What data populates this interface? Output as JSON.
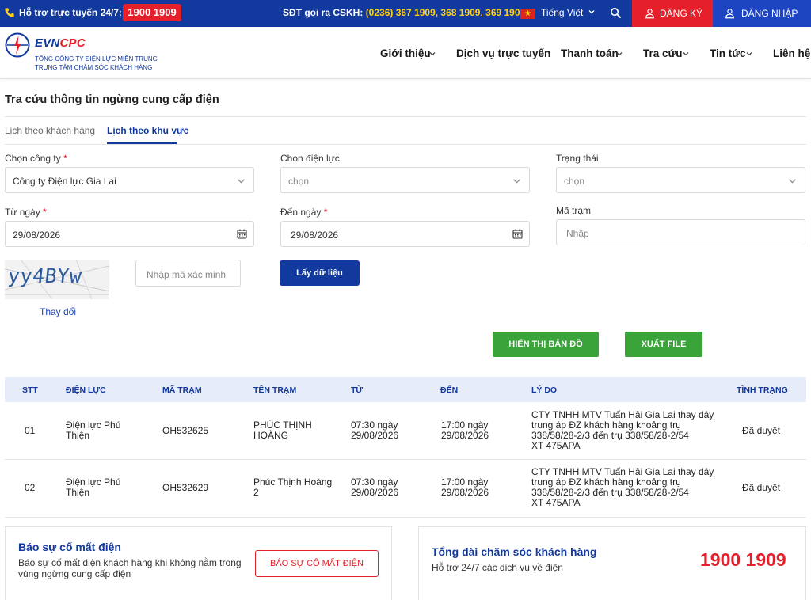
{
  "topbar": {
    "hotline_label": "Hỗ trợ trực tuyến 24/7:",
    "hotline_number": "1900 1909",
    "cskh_label": "SĐT gọi ra CSKH:",
    "cskh_numbers": "(0236) 367 1909, 368 1909, 369 1909",
    "language": "Tiếng Việt",
    "register": "ĐĂNG KÝ",
    "login": "ĐĂNG NHẬP"
  },
  "header": {
    "logo_evn": "EVN",
    "logo_cpc": "CPC",
    "logo_sub1": "TỔNG CÔNG TY ĐIỆN LỰC MIỀN TRUNG",
    "logo_sub2": "TRUNG TÂM CHĂM SÓC KHÁCH HÀNG",
    "nav": [
      "Giới thiệu",
      "Dịch vụ trực tuyến",
      "Thanh toán",
      "Tra cứu",
      "Tin tức",
      "Liên hệ"
    ]
  },
  "page": {
    "title": "Tra cứu thông tin ngừng cung cấp điện",
    "tabs": [
      "Lịch theo khách hàng",
      "Lịch theo khu vực"
    ]
  },
  "form": {
    "company_label": "Chọn công ty",
    "company_value": "Công ty Điện lực Gia Lai",
    "branch_label": "Chọn điện lực",
    "branch_value": "chọn",
    "status_label": "Trạng thái",
    "status_value": "chọn",
    "from_label": "Từ ngày",
    "from_value": "29/08/2026",
    "to_label": "Đến ngày",
    "to_value": "29/08/2026",
    "station_label": "Mã trạm",
    "station_placeholder": "Nhập",
    "captcha_text": "yy4BYw",
    "captcha_placeholder": "Nhập mã xác minh",
    "change_link": "Thay đổi",
    "fetch_button": "Lấy dữ liệu",
    "required_mark": "*"
  },
  "actions": {
    "show_map": "HIỂN THỊ BẢN ĐỒ",
    "export_file": "XUẤT FILE"
  },
  "table": {
    "headers": [
      "STT",
      "ĐIỆN LỰC",
      "MÃ TRẠM",
      "TÊN TRẠM",
      "TỪ",
      "ĐẾN",
      "LÝ DO",
      "TÌNH TRẠNG"
    ],
    "rows": [
      {
        "stt": "01",
        "dien_luc": [
          "Điện lực Phú",
          "Thiện"
        ],
        "ma_tram": "OH532625",
        "ten_tram": [
          "PHÚC THỊNH",
          "HOÀNG"
        ],
        "tu": [
          "07:30 ngày",
          "29/08/2026"
        ],
        "den": [
          "17:00 ngày",
          "29/08/2026"
        ],
        "ly_do": [
          "CTY TNHH MTV Tuấn Hải Gia Lai thay dây",
          "trung áp ĐZ khách hàng khoảng trụ",
          "338/58/28-2/3 đến trụ 338/58/28-2/54",
          "XT 475APA"
        ],
        "tinh_trang": "Đã duyệt"
      },
      {
        "stt": "02",
        "dien_luc": [
          "Điện lực Phú",
          "Thiện"
        ],
        "ma_tram": "OH532629",
        "ten_tram": [
          "Phúc Thịnh Hoàng",
          "2"
        ],
        "tu": [
          "07:30 ngày",
          "29/08/2026"
        ],
        "den": [
          "17:00 ngày",
          "29/08/2026"
        ],
        "ly_do": [
          "CTY TNHH MTV Tuấn Hải Gia Lai thay dây",
          "trung áp ĐZ khách hàng khoảng trụ",
          "338/58/28-2/3 đến trụ 338/58/28-2/54",
          "XT 475APA"
        ],
        "tinh_trang": "Đã duyệt"
      }
    ]
  },
  "bottom": {
    "report_title": "Báo sự cố mất điện",
    "report_desc": [
      "Báo sự cố mất điện khách hàng khi không nằm trong",
      "vùng ngừng cung cấp điện"
    ],
    "report_button": "BÁO SỰ CỐ MẤT ĐIỆN",
    "support_title": "Tổng đài chăm sóc khách hàng",
    "support_desc": "Hỗ trợ 24/7 các dịch vụ về điện",
    "support_number": "1900 1909"
  },
  "colors": {
    "brand_blue": "#12399e",
    "brand_red": "#e5202a",
    "accent_green": "#3aa33a",
    "hotline_yellow": "#ffd21a"
  }
}
